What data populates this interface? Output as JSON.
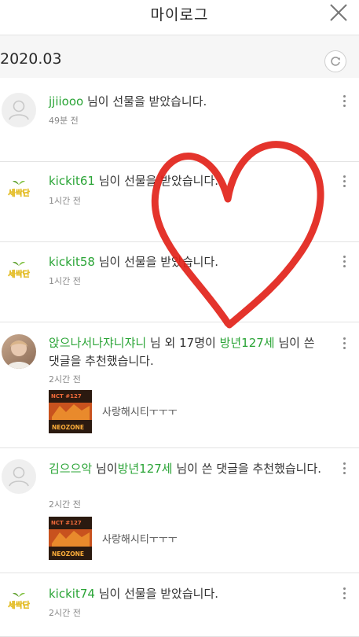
{
  "header": {
    "title": "마이로그"
  },
  "date_bar": {
    "date": "2020.03"
  },
  "items": [
    {
      "user": "jjiiooo",
      "message": " 님이 선물을 받았습니다.",
      "time": "49분 전"
    },
    {
      "user": "kickit61",
      "message": " 님이 선물을 받았습니다.",
      "time": "1시간 전",
      "logo_text": "세싹단"
    },
    {
      "user": "kickit58",
      "message": " 님이 선물을 받았습니다.",
      "time": "1시간 전",
      "logo_text": "세싹단"
    },
    {
      "user": "앉으나서나쟈니쟈니",
      "mid": " 님 외 17명이 ",
      "target": "방년127세",
      "message": " 님이 쓴 댓글을 추천했습니다.",
      "time": "2시간 전",
      "comment": "사랑해시티ㅜㅜㅜ",
      "thumb_top": "NCT #127",
      "thumb_bottom": "NEOZONE"
    },
    {
      "user": "김으으악",
      "mid": " 님이",
      "target": "방년127세",
      "message": " 님이 쓴 댓글을 추천했습니다.",
      "time": "2시간 전",
      "comment": "사랑해시티ㅜㅜㅜ",
      "thumb_top": "NCT #127",
      "thumb_bottom": "NEOZONE"
    },
    {
      "user": "kickit74",
      "message": " 님이 선물을 받았습니다.",
      "time": "2시간 전",
      "logo_text": "세싹단"
    }
  ]
}
